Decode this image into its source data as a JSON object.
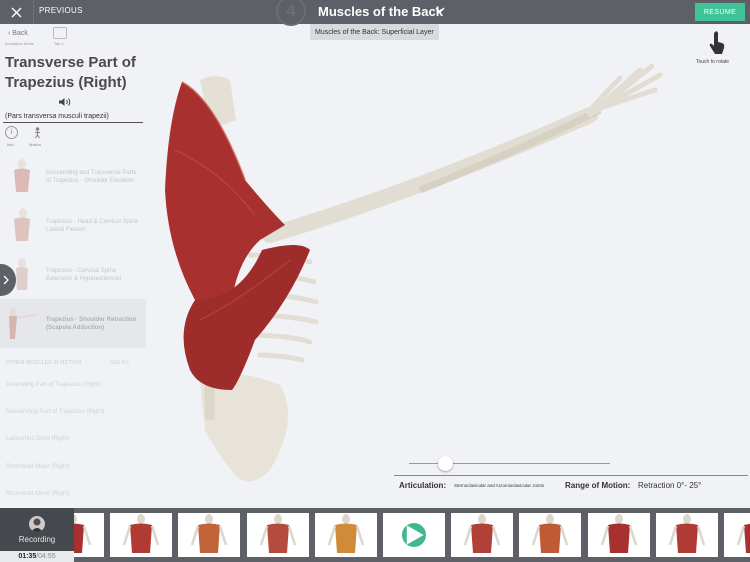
{
  "topbar": {
    "close_icon": "close-icon",
    "previous_label": "PREVIOUS",
    "step_number": "4",
    "title": "Muscles of the Back",
    "resume_label": "RESUME",
    "colors": {
      "bar": "#5d6066",
      "resume": "#3fc397"
    }
  },
  "layer_label": "Muscles of the Back: Superficial Layer",
  "sidebar": {
    "back_label": "Back",
    "back_sub": "Animation Mode",
    "tab_sub": "Tab 1",
    "muscle_name": "Transverse Part of Trapezius (Right)",
    "speaker_icon": "speaker-icon",
    "latin_name": "(Pars transversa musculi trapezii)",
    "info_label": "Info",
    "motion_label": "Motion",
    "motions": [
      {
        "label": "Descending and Transverse Parts of Trapezius - Shoulder Elevation",
        "active": false
      },
      {
        "label": "Trapezius - Head & Cervical Spine Lateral Flexion",
        "active": false
      },
      {
        "label": "Trapezius - Cervical Spine Extension & Hyperextension",
        "active": false
      },
      {
        "label": "Trapezius - Shoulder Retraction (Scapula Adduction)",
        "active": true
      }
    ],
    "other_header": "OTHER MUSCLES IN MOTION",
    "see_all": "SEE ALL",
    "other_muscles": [
      "Ascending Part of Trapezius (Right)",
      "Descending Part of Trapezius (Right)",
      "Latissimus Dorsi (Right)",
      "Rhomboid Major (Right)",
      "Rhomboid Minor (Right)"
    ]
  },
  "viewport": {
    "touch_rotate_label": "Touch to rotate",
    "slider_value_fraction": 0.18,
    "articulation_label": "Articulation:",
    "articulation_value": "Sternoclavicular and Acromioclavicular Joints",
    "range_label": "Range of Motion:",
    "range_value": "Retraction 0°- 25°"
  },
  "bottombar": {
    "recording_label": "Recording",
    "current_time": "01:35",
    "total_time": "/04:55",
    "thumbnails": [
      {
        "name": "clip-1",
        "active": false
      },
      {
        "name": "clip-2",
        "active": false
      },
      {
        "name": "clip-3",
        "active": false
      },
      {
        "name": "clip-4",
        "active": false
      },
      {
        "name": "clip-5",
        "active": false
      },
      {
        "name": "clip-6",
        "active": true
      },
      {
        "name": "clip-7",
        "active": false
      },
      {
        "name": "clip-8",
        "active": false
      },
      {
        "name": "clip-9",
        "active": false
      },
      {
        "name": "clip-10",
        "active": false
      },
      {
        "name": "clip-11",
        "active": false
      }
    ]
  }
}
